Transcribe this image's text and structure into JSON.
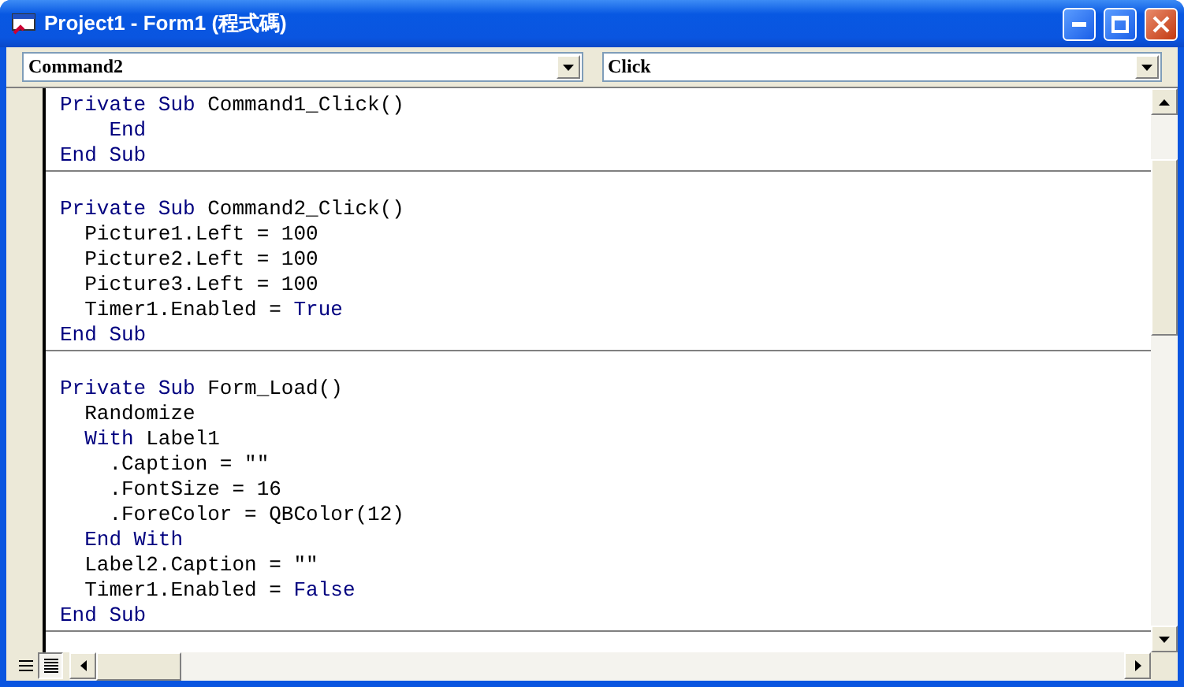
{
  "window": {
    "title": "Project1 - Form1 (程式碼)"
  },
  "object_list": {
    "value": "Command2"
  },
  "procedure_list": {
    "value": "Click"
  },
  "procedures": [
    {
      "lines": [
        [
          {
            "text": "Private Sub ",
            "kind": "keyword"
          },
          {
            "text": "Command1_Click()",
            "kind": "plain"
          }
        ],
        [
          {
            "text": "    End",
            "kind": "keyword"
          }
        ],
        [
          {
            "text": "End Sub",
            "kind": "keyword"
          }
        ]
      ]
    },
    {
      "lines": [
        [
          {
            "text": "Private Sub ",
            "kind": "keyword"
          },
          {
            "text": "Command2_Click()",
            "kind": "plain"
          }
        ],
        [
          {
            "text": "  Picture1.Left = 100",
            "kind": "plain"
          }
        ],
        [
          {
            "text": "  Picture2.Left = 100",
            "kind": "plain"
          }
        ],
        [
          {
            "text": "  Picture3.Left = 100",
            "kind": "plain"
          }
        ],
        [
          {
            "text": "  Timer1.Enabled = ",
            "kind": "plain"
          },
          {
            "text": "True",
            "kind": "keyword"
          }
        ],
        [
          {
            "text": "End Sub",
            "kind": "keyword"
          }
        ]
      ]
    },
    {
      "lines": [
        [
          {
            "text": "Private Sub ",
            "kind": "keyword"
          },
          {
            "text": "Form_Load()",
            "kind": "plain"
          }
        ],
        [
          {
            "text": "  Randomize",
            "kind": "plain"
          }
        ],
        [
          {
            "text": "  With ",
            "kind": "keyword"
          },
          {
            "text": "Label1",
            "kind": "plain"
          }
        ],
        [
          {
            "text": "    .Caption = \"\"",
            "kind": "plain"
          }
        ],
        [
          {
            "text": "    .FontSize = 16",
            "kind": "plain"
          }
        ],
        [
          {
            "text": "    .ForeColor = QBColor(12)",
            "kind": "plain"
          }
        ],
        [
          {
            "text": "  End With",
            "kind": "keyword"
          }
        ],
        [
          {
            "text": "  Label2.Caption = \"\"",
            "kind": "plain"
          }
        ],
        [
          {
            "text": "  Timer1.Enabled = ",
            "kind": "plain"
          },
          {
            "text": "False",
            "kind": "keyword"
          }
        ],
        [
          {
            "text": "End Sub",
            "kind": "keyword"
          }
        ]
      ]
    }
  ],
  "view_buttons": [
    {
      "kind": "procedure",
      "selected": false
    },
    {
      "kind": "module",
      "selected": true
    }
  ]
}
